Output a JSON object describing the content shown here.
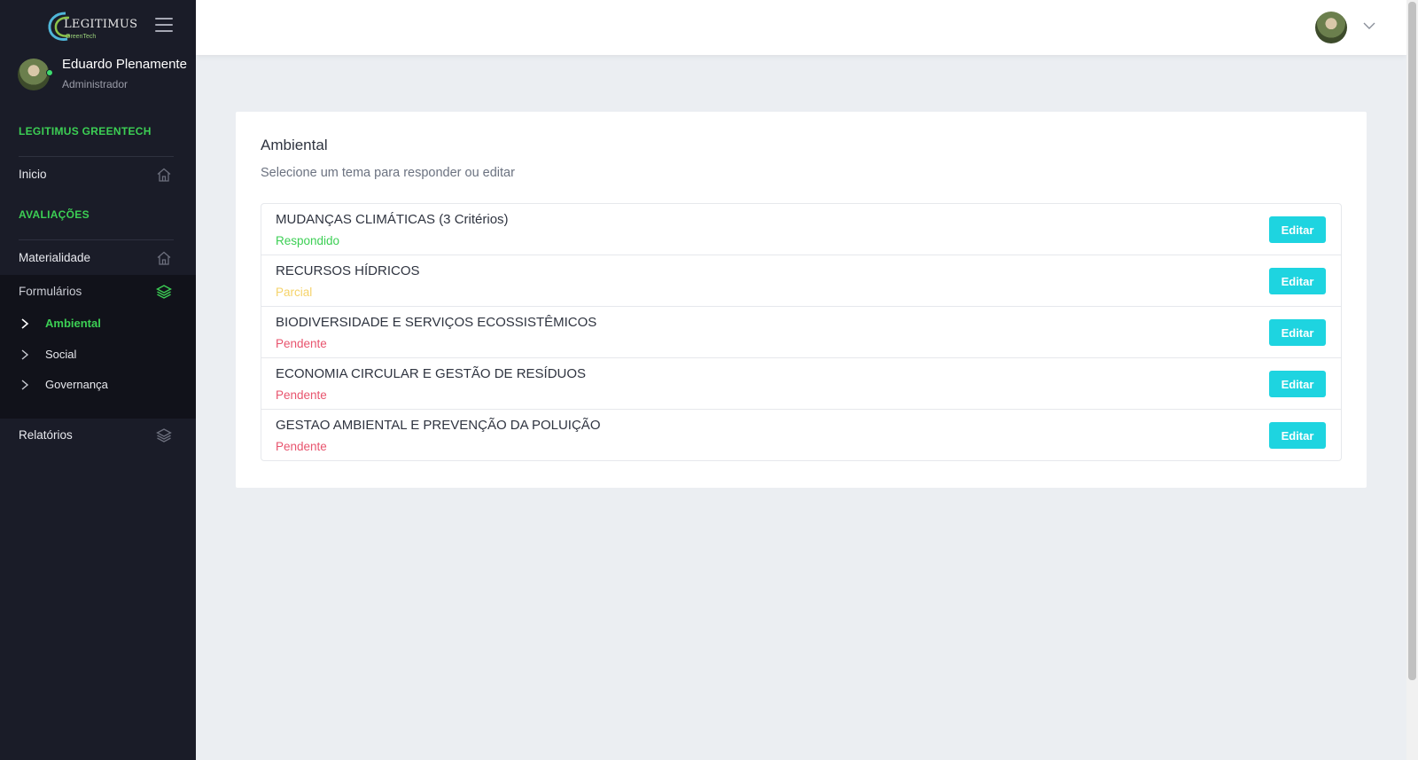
{
  "brand": {
    "name": "LEGITIMUS",
    "tagline": "GreenTech"
  },
  "user": {
    "name": "Eduardo Plenamente",
    "role": "Administrador"
  },
  "sidebar": {
    "sections": [
      {
        "title": "LEGITIMUS GREENTECH"
      },
      {
        "title": "AVALIAÇÕES"
      }
    ],
    "items": {
      "inicio": "Inicio",
      "materialidade": "Materialidade",
      "formularios": "Formulários",
      "relatorios": "Relatórios"
    },
    "sub_items": [
      "Ambiental",
      "Social",
      "Governança"
    ],
    "active_sub_item": "Ambiental"
  },
  "main": {
    "title": "Ambiental",
    "subtitle": "Selecione um tema para responder ou editar",
    "edit_label": "Editar",
    "topics": [
      {
        "title": "MUDANÇAS CLIMÁTICAS (3 Critérios)",
        "status": "Respondido"
      },
      {
        "title": "RECURSOS HÍDRICOS",
        "status": "Parcial"
      },
      {
        "title": "BIODIVERSIDADE E SERVIÇOS ECOSSISTÊMICOS",
        "status": "Pendente"
      },
      {
        "title": "ECONOMIA CIRCULAR E GESTÃO DE RESÍDUOS",
        "status": "Pendente"
      },
      {
        "title": "GESTAO AMBIENTAL E PREVENÇÃO DA POLUIÇÃO",
        "status": "Pendente"
      }
    ]
  },
  "colors": {
    "sidebar_bg": "#1a1c28",
    "accent_green": "#3ccf54",
    "button_cyan": "#1ed4e0",
    "status_respondido": "#3ccf54",
    "status_parcial": "#f5d36a",
    "status_pendente": "#e8546e"
  },
  "icons": {
    "menu": "hamburger-icon",
    "home": "home-icon",
    "layers": "layers-icon",
    "chevron_right": "chevron-right-icon",
    "chevron_down": "chevron-down-icon"
  }
}
